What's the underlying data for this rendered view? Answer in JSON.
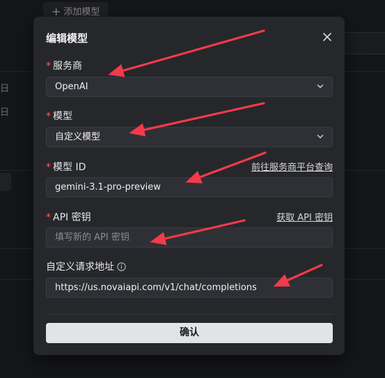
{
  "background": {
    "add_model_button": "添加模型",
    "side_stub_1": "日",
    "side_stub_2": "日"
  },
  "modal": {
    "title": "编辑模型",
    "fields": {
      "provider": {
        "label": "服务商",
        "value": "OpenAI"
      },
      "model": {
        "label": "模型",
        "value": "自定义模型"
      },
      "model_id": {
        "label": "模型 ID",
        "link": "前往服务商平台查询",
        "value": "gemini-3.1-pro-preview"
      },
      "api_key": {
        "label": "API 密钥",
        "link": "获取 API 密钥",
        "placeholder": "填写新的 API 密钥"
      },
      "custom_url": {
        "label": "自定义请求地址",
        "value": "https://us.novaiapi.com/v1/chat/completions"
      }
    },
    "confirm_label": "确认"
  },
  "colors": {
    "required_star": "#ff5a5a",
    "annotation_arrow": "#f23b4a",
    "confirm_bg": "#e2e3e6"
  }
}
